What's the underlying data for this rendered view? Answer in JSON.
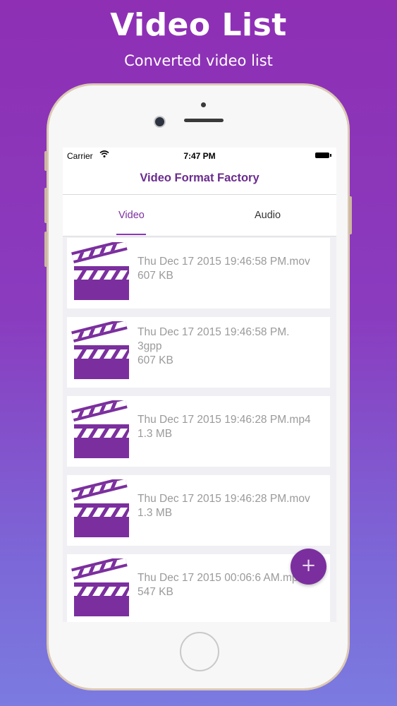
{
  "promo": {
    "title": "Video List",
    "subtitle": "Converted video list"
  },
  "status_bar": {
    "carrier": "Carrier",
    "time": "7:47 PM",
    "icons": [
      "wifi-icon",
      "battery-icon"
    ]
  },
  "nav": {
    "title": "Video Format Factory"
  },
  "tabs": [
    {
      "label": "Video",
      "active": true
    },
    {
      "label": "Audio",
      "active": false
    }
  ],
  "videos": [
    {
      "name": "Thu Dec 17 2015 19:46:58 PM.mov",
      "size": "607 KB",
      "icon": "clapperboard-icon"
    },
    {
      "name": "Thu Dec 17 2015 19:46:58 PM.\n3gpp",
      "size": "607 KB",
      "icon": "clapperboard-icon"
    },
    {
      "name": "Thu Dec 17 2015 19:46:28 PM.mp4",
      "size": "1.3 MB",
      "icon": "clapperboard-icon"
    },
    {
      "name": "Thu Dec 17 2015 19:46:28 PM.mov",
      "size": "1.3 MB",
      "icon": "clapperboard-icon"
    },
    {
      "name": "Thu Dec 17 2015 00:06:6 AM.mp4",
      "size": "547 KB",
      "icon": "clapperboard-icon"
    }
  ],
  "fab": {
    "label": "+",
    "icon": "plus-icon"
  },
  "colors": {
    "accent": "#7b2f9e",
    "background_top": "#8e2fb4",
    "background_bottom": "#7b7be0",
    "secondary_text": "#9a9a9a"
  }
}
